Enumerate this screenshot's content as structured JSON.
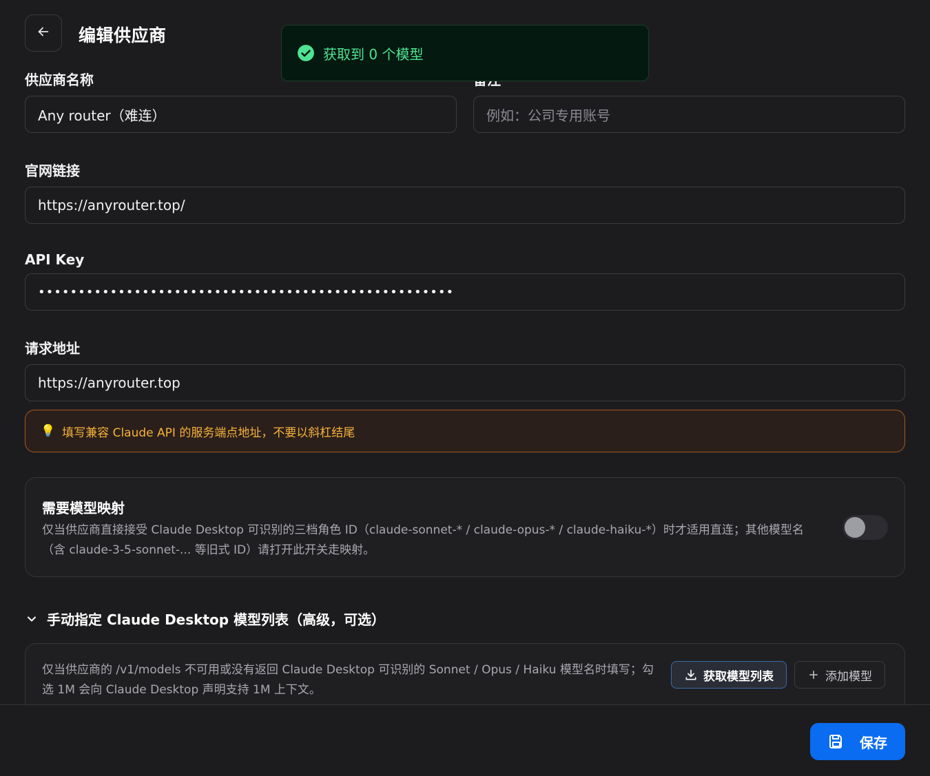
{
  "header": {
    "title": "编辑供应商"
  },
  "toast": {
    "message": "获取到 0 个模型",
    "color": "#4fe394"
  },
  "form": {
    "name_label": "供应商名称",
    "name_value": "Any router（难连）",
    "note_label": "备注",
    "note_placeholder": "例如：公司专用账号",
    "website_label": "官网链接",
    "website_value": "https://anyrouter.top/",
    "apikey_label": "API Key",
    "apikey_value": "••••••••••••••••••••••••••••••••••••••••••••••••••••",
    "endpoint_label": "请求地址",
    "endpoint_value": "https://anyrouter.top",
    "endpoint_hint": "填写兼容 Claude API 的服务端点地址，不要以斜杠结尾"
  },
  "mapping": {
    "title": "需要模型映射",
    "description": "仅当供应商直接接受 Claude Desktop 可识别的三档角色 ID（claude-sonnet-* / claude-opus-* / claude-haiku-*）时才适用直连；其他模型名（含 claude-3-5-sonnet-... 等旧式 ID）请打开此开关走映射。",
    "enabled": false
  },
  "models_section": {
    "title": "手动指定 Claude Desktop 模型列表（高级，可选）",
    "expanded": true,
    "description": "仅当供应商的 /v1/models 不可用或没有返回 Claude Desktop 可识别的 Sonnet / Opus / Haiku 模型名时填写；勾选 1M 会向 Claude Desktop 声明支持 1M 上下文。",
    "fetch_button": "获取模型列表",
    "add_button": "添加模型"
  },
  "footer": {
    "save_button": "保存",
    "accent": "#0a6cf0"
  }
}
